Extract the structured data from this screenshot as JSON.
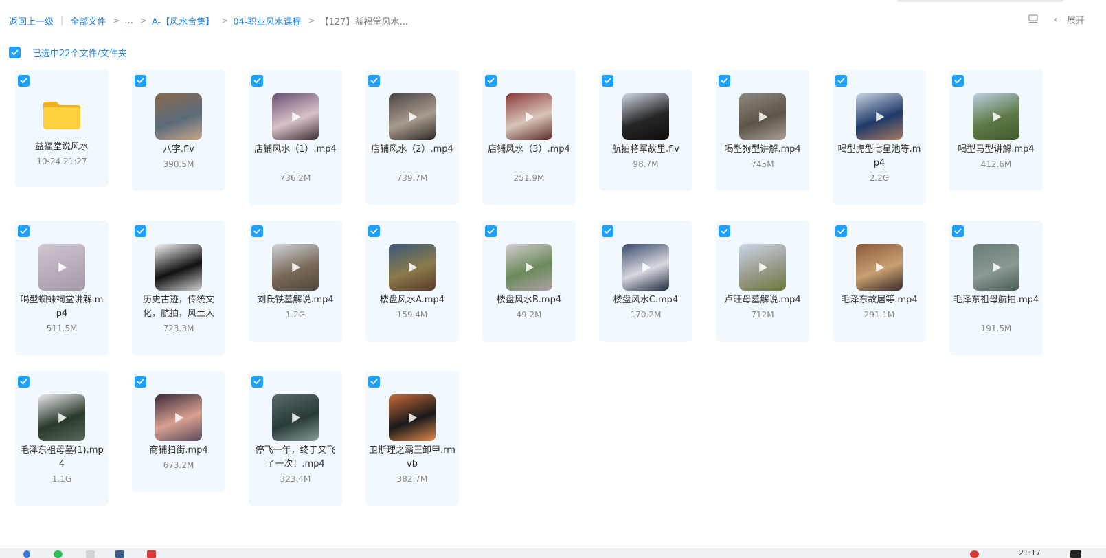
{
  "breadcrumb": {
    "back": "返回上一级",
    "items": [
      "全部文件",
      "...",
      "A-【风水合集】",
      "04-职业风水课程"
    ],
    "current": "【127】益福堂风水..."
  },
  "header": {
    "expand_label": "展开"
  },
  "selection": {
    "label": "已选中22个文件/文件夹"
  },
  "files": [
    {
      "name": "益福堂说风水",
      "meta": "10-24 21:27",
      "type": "folder"
    },
    {
      "name": "八字.flv",
      "meta": "390.5M",
      "type": "image",
      "colors": [
        "#8a6a4e",
        "#5a6a7a",
        "#c9a788"
      ]
    },
    {
      "name": "店铺风水（1）.mp4",
      "meta": "736.2M",
      "type": "video",
      "colors": [
        "#6a4f72",
        "#d8c2c7",
        "#3b2d36"
      ]
    },
    {
      "name": "店铺风水（2）.mp4",
      "meta": "739.7M",
      "type": "video",
      "colors": [
        "#4a4645",
        "#a89a8d",
        "#2e2a28"
      ]
    },
    {
      "name": "店铺风水（3）.mp4",
      "meta": "251.9M",
      "type": "video",
      "colors": [
        "#8c3a3a",
        "#d8c4b8",
        "#5c2a2a"
      ]
    },
    {
      "name": "航拍将军故里.flv",
      "meta": "98.7M",
      "type": "image",
      "colors": [
        "#cdd6e0",
        "#262626",
        "#0e0e0e"
      ]
    },
    {
      "name": "喝型狗型讲解.mp4",
      "meta": "745M",
      "type": "video",
      "colors": [
        "#8d8880",
        "#5c5548",
        "#a7a098"
      ]
    },
    {
      "name": "喝型虎型七星池等.mp4",
      "meta": "2.2G",
      "type": "video",
      "colors": [
        "#c7d2df",
        "#1f3a6a",
        "#a8795f"
      ]
    },
    {
      "name": "喝型马型讲解.mp4",
      "meta": "412.6M",
      "type": "video",
      "colors": [
        "#b8cfe0",
        "#5e7a46",
        "#3f5a2c"
      ]
    },
    {
      "name": "喝型蜘蛛祠堂讲解.mp4",
      "meta": "511.5M",
      "type": "video",
      "colors": [
        "#cfc6cf",
        "#b7acb9",
        "#a49aa6"
      ]
    },
    {
      "name": "历史古迹，传统文化，航拍，风土人",
      "meta": "723.3M",
      "type": "image",
      "colors": [
        "#f4f4f4",
        "#111111",
        "#d0d0d0"
      ]
    },
    {
      "name": "刘氏铁墓解说.mp4",
      "meta": "1.2G",
      "type": "video",
      "colors": [
        "#cfd4d8",
        "#7a6a5a",
        "#4e463c"
      ]
    },
    {
      "name": "楼盘风水A.mp4",
      "meta": "159.4M",
      "type": "video",
      "colors": [
        "#3b5a7a",
        "#8a7a4a",
        "#5a3a2a"
      ]
    },
    {
      "name": "楼盘风水B.mp4",
      "meta": "49.2M",
      "type": "video",
      "colors": [
        "#d4ccd0",
        "#6a8a5a",
        "#b0a0a8"
      ]
    },
    {
      "name": "楼盘风水C.mp4",
      "meta": "170.2M",
      "type": "video",
      "colors": [
        "#3a4a6a",
        "#d8d8e0",
        "#1e2a3e"
      ]
    },
    {
      "name": "卢旺母墓解说.mp4",
      "meta": "712M",
      "type": "video",
      "colors": [
        "#c8d6e6",
        "#9a9a8a",
        "#6a7a3a"
      ]
    },
    {
      "name": "毛泽东故居等.mp4",
      "meta": "291.1M",
      "type": "video",
      "colors": [
        "#8a5a3a",
        "#c8a070",
        "#3a2a2a"
      ]
    },
    {
      "name": "毛泽东祖母航拍.mp4",
      "meta": "191.5M",
      "type": "video",
      "colors": [
        "#6a7a76",
        "#8a9a92",
        "#4a5a56"
      ]
    },
    {
      "name": "毛泽东祖母墓(1).mp4",
      "meta": "1.1G",
      "type": "video",
      "colors": [
        "#e8e8ec",
        "#2a3a2a",
        "#5a6a5a"
      ]
    },
    {
      "name": "商铺扫街.mp4",
      "meta": "673.2M",
      "type": "video",
      "colors": [
        "#3a2a3a",
        "#d8a090",
        "#5a4a5a"
      ]
    },
    {
      "name": "停飞一年，终于又飞了一次！.mp4",
      "meta": "323.4M",
      "type": "video",
      "colors": [
        "#5a6a6a",
        "#2a3a3a",
        "#8a9a9a"
      ]
    },
    {
      "name": "卫斯理之霸王卸甲.rmvb",
      "meta": "382.7M",
      "type": "video",
      "colors": [
        "#c86a3a",
        "#1a1a1a",
        "#e08a4a"
      ]
    }
  ],
  "taskbar": {
    "clock": "21:17"
  }
}
